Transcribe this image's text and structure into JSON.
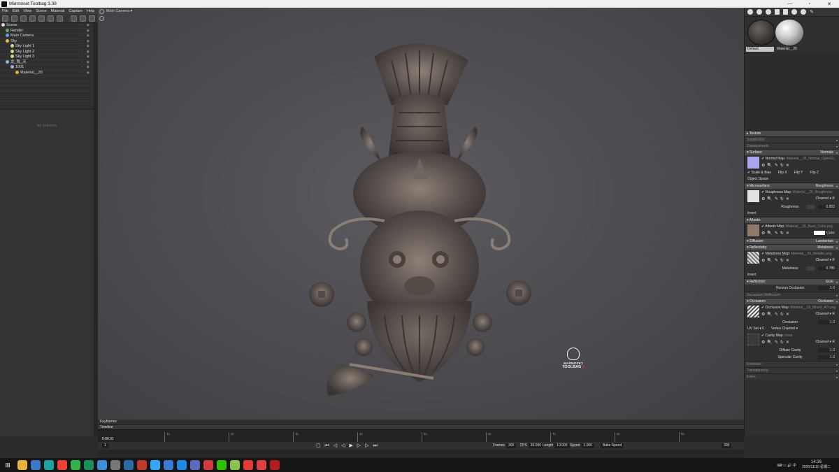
{
  "window": {
    "title": "Marmoset Toolbag 3.08"
  },
  "menu": [
    "File",
    "Edit",
    "View",
    "Scene",
    "Material",
    "Capture",
    "Help"
  ],
  "scene_tree": [
    {
      "label": "Scene",
      "depth": 0,
      "color": "#d9d9d9"
    },
    {
      "label": "Render",
      "depth": 1,
      "color": "#5fb35f"
    },
    {
      "label": "Main Camera",
      "depth": 1,
      "color": "#6aa0e0"
    },
    {
      "label": "Sky",
      "depth": 1,
      "color": "#e2c14b"
    },
    {
      "label": "Sky Light 1",
      "depth": 2,
      "color": "#cfd98a"
    },
    {
      "label": "Sky Light 2",
      "depth": 2,
      "color": "#cfd98a"
    },
    {
      "label": "Sky Light 3",
      "depth": 2,
      "color": "#cfd98a"
    },
    {
      "label": "龙_我_天",
      "depth": 1,
      "color": "#8ab7e0"
    },
    {
      "label": "1001",
      "depth": 2,
      "color": "#8ab7e0"
    },
    {
      "label": "Material__26",
      "depth": 3,
      "color": "#e2a94b"
    }
  ],
  "properties": {
    "empty_text": "No Selection"
  },
  "viewport": {
    "camera_label": "Main Camera ▾"
  },
  "watermark": {
    "line1": "MARMOSET",
    "line2": "TOOLBAG",
    "num": "3"
  },
  "materials": {
    "swatches": [
      "Default",
      "Material__26"
    ],
    "sections": {
      "texture": "▸ Texture",
      "subdivision": "Subdivision:",
      "displacement": "Displacement:",
      "surface": "▾ Surface:",
      "surface_val": "Normals",
      "normal_map_label": "✔ Normal Map:",
      "normal_map_path": "Material__26_Normal_OpenGL",
      "scale_bias": "✔ Scale & Bias",
      "flip_x": "Flip X",
      "flip_y": "Flip Y",
      "flip_z": "Flip Z",
      "object_space": "Object Space",
      "microsurface": "▾ Microsurface:",
      "microsurface_val": "Roughness",
      "roughness_map_label": "✔ Roughness Map:",
      "roughness_map_path": "Material__26_Roughness",
      "channel": "Channel ▾ R",
      "roughness": "Roughness",
      "roughness_val": "0.853",
      "invert": "Invert",
      "albedo": "▾ Albedo:",
      "albedo_map_label": "✔ Albedo Map:",
      "albedo_map_path": "Material__26_Base_Color.png",
      "color": "Color",
      "diffusion": "▾ Diffusion:",
      "diffusion_val": "Lambertian",
      "reflectivity": "▾ Reflectivity:",
      "reflectivity_val": "Metalness",
      "metalness_map_label": "✔ Metalness Map:",
      "metalness_map_path": "Material__26_Metallic.png",
      "metalness": "Metalness",
      "metalness_val": "0.785",
      "invert2": "Invert",
      "reflection": "▾ Reflection:",
      "reflection_val": "GGX",
      "horizon_occlusion": "Horizon Occlusion",
      "horizon_val": "1.0",
      "secondary_reflection": "Secondary Reflection:",
      "occlusion_sec": "▾ Occlusion:",
      "occlusion_sec_val": "Occlusion",
      "occlusion_map_label": "✔ Occlusion Map:",
      "occlusion_map_path": "Material__26_Mixed_AO.png",
      "occlusion": "Occlusion",
      "occlusion_val": "1.0",
      "uv_set": "UV Set ▾ 0",
      "vertex_channel": "Vertex Channel ▾",
      "cavity_map_label": "✔ Cavity Map:",
      "cavity_map_path": "none",
      "diffuse_cavity": "Diffuse Cavity",
      "diffuse_cavity_val": "1.0",
      "specular_cavity": "Specular Cavity",
      "specular_cavity_val": "1.0",
      "emissive": "Emissive:",
      "transparency": "Transparency:",
      "extra": "Extra:"
    }
  },
  "timeline": {
    "keyframes": "Keyframes",
    "timeline": "Timeline",
    "time": "0:00.01",
    "ticks": [
      "1s",
      "2s",
      "3s",
      "4s",
      "5s",
      "6s",
      "7s",
      "8s",
      "9s"
    ],
    "start_frame": "1",
    "frames_label": "Frames",
    "frames": "300",
    "fps_label": "FPS",
    "fps": "30.000",
    "length_label": "Length",
    "length": "10.000",
    "speed_label": "Speed",
    "speed": "1.000",
    "bake_speed": "Bake Speed",
    "end_frame": "300"
  },
  "taskbar": {
    "apps": [
      "#e6b23c",
      "#3a78c9",
      "#1aa3a3",
      "#ea4335",
      "#2fb34a",
      "#1b8f5a",
      "#3a8fd6",
      "#777777",
      "#2b6aa8",
      "#c0392b",
      "#31a8ff",
      "#3a7bd5",
      "#1e88e5",
      "#5c6bc0",
      "#d23b3b",
      "#2dc100",
      "#8bc34a",
      "#e53935",
      "#e04040",
      "#b71c1c"
    ],
    "time": "14:26",
    "date": "2020/11/10 星期二"
  },
  "colors": {
    "accent": "#e23a3a",
    "panel": "#2f2f2f",
    "viewport": "#4e4d52"
  }
}
